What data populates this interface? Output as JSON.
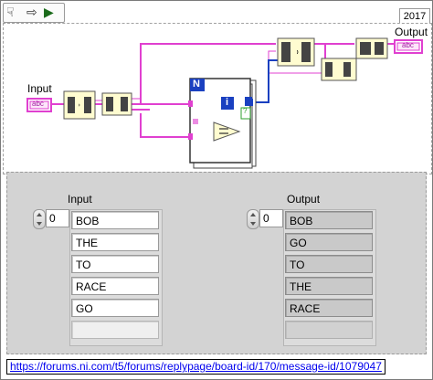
{
  "toolbar": {
    "icons": [
      "hand-icon",
      "arrow-icon",
      "run-icon"
    ],
    "year_tab": "2017"
  },
  "diagram": {
    "input_label": "Input",
    "output_label": "Output",
    "input_terminal": "abc",
    "output_terminal": "abc",
    "loop_count_label": "N",
    "iteration_label": "i",
    "conditional_label": "?"
  },
  "front_panel": {
    "input": {
      "label": "Input",
      "index": "0",
      "items": [
        "BOB",
        "THE",
        "TO",
        "RACE",
        "GO",
        ""
      ]
    },
    "output": {
      "label": "Output",
      "index": "0",
      "items": [
        "BOB",
        "GO",
        "TO",
        "THE",
        "RACE",
        ""
      ]
    }
  },
  "footer": {
    "url": "https://forums.ni.com/t5/forums/replypage/board-id/170/message-id/1079047"
  },
  "colors": {
    "string_wire": "#e040d0",
    "numeric_wire": "#1a40c0",
    "bool_wire": "#2ea02e",
    "node_fill": "#fffcd0"
  }
}
